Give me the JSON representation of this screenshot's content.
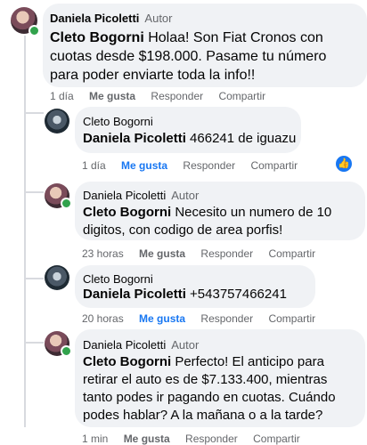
{
  "comments": [
    {
      "author": "Daniela Picoletti",
      "author_tag": "Autor",
      "mention": "Cleto Bogorni",
      "text": " Holaa! Son Fiat Cronos con cuotas desde $198.000. Pasame tu número para poder enviarte toda la info!!",
      "time": "1 día",
      "like": "Me gusta",
      "reply": "Responder",
      "share": "Compartir"
    },
    {
      "author": "Cleto Bogorni",
      "mention": "Daniela Picoletti",
      "text": " 466241 de iguazu",
      "time": "1 día",
      "like": "Me gusta",
      "reply": "Responder",
      "share": "Compartir"
    },
    {
      "author": "Daniela Picoletti",
      "author_tag": "Autor",
      "mention": "Cleto Bogorni",
      "text": " Necesito un numero de 10 digitos, con codigo de area porfis!",
      "time": "23 horas",
      "like": "Me gusta",
      "reply": "Responder",
      "share": "Compartir"
    },
    {
      "author": "Cleto Bogorni",
      "mention": "Daniela Picoletti",
      "text": " +543757466241",
      "time": "20 horas",
      "like": "Me gusta",
      "reply": "Responder",
      "share": "Compartir"
    },
    {
      "author": "Daniela Picoletti",
      "author_tag": "Autor",
      "mention": "Cleto Bogorni",
      "text": " Perfecto! El anticipo para retirar el auto es de $7.133.400, mientras tanto podes ir pagando en cuotas. Cuándo podes hablar? A la mañana o a la tarde?",
      "time": "1 min",
      "like": "Me gusta",
      "reply": "Responder",
      "share": "Compartir"
    }
  ],
  "reaction_icon": "thumbs-up-icon",
  "colors": {
    "link_blue": "#1877f2",
    "bubble_bg": "#f0f2f5",
    "online": "#31a24c"
  }
}
